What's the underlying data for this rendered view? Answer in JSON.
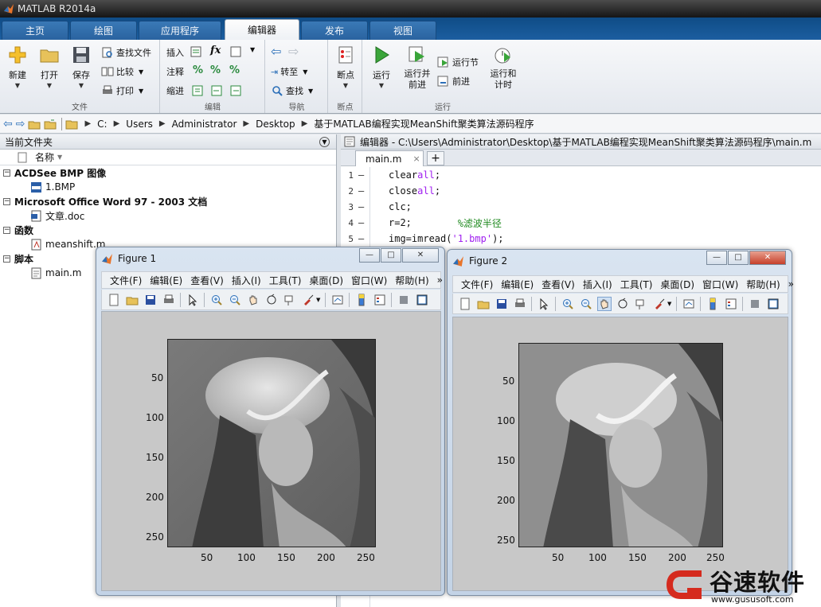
{
  "window": {
    "title": "MATLAB R2014a"
  },
  "tabs": [
    {
      "label": "主页"
    },
    {
      "label": "绘图"
    },
    {
      "label": "应用程序"
    },
    {
      "label": "编辑器",
      "active": true
    },
    {
      "label": "发布"
    },
    {
      "label": "视图"
    }
  ],
  "ribbon": {
    "file": {
      "label": "文件",
      "new": "新建",
      "open": "打开",
      "save": "保存",
      "find_files": "查找文件",
      "compare": "比较",
      "print": "打印"
    },
    "edit": {
      "label": "编辑",
      "insert": "插入",
      "comment": "注释",
      "indent": "缩进",
      "fx": "fx"
    },
    "navigate": {
      "label": "导航",
      "goto": "转至",
      "find": "查找"
    },
    "breakpoints": {
      "label": "断点",
      "breakpoint": "断点"
    },
    "run": {
      "label": "运行",
      "run": "运行",
      "run_advance": "运行并\n前进",
      "run_section": "运行节",
      "advance": "前进",
      "run_time": "运行和\n计时"
    }
  },
  "path": {
    "crumbs": [
      "C:",
      "Users",
      "Administrator",
      "Desktop",
      "基于MATLAB编程实现MeanShift聚类算法源码程序"
    ]
  },
  "current_folder": {
    "title": "当前文件夹",
    "name_col": "名称",
    "groups": [
      {
        "label": "ACDSee BMP 图像",
        "files": [
          "1.BMP"
        ]
      },
      {
        "label": "Microsoft Office Word 97 - 2003 文档",
        "files": [
          "文章.doc"
        ]
      },
      {
        "label": "函数",
        "files": [
          "meanshift.m"
        ]
      },
      {
        "label": "脚本",
        "files": [
          "main.m"
        ]
      }
    ]
  },
  "editor": {
    "title": "编辑器 - C:\\Users\\Administrator\\Desktop\\基于MATLAB编程实现MeanShift聚类算法源码程序\\main.m",
    "tab": "main.m",
    "close_symbol": "×",
    "plus_symbol": "+",
    "lines": [
      {
        "n": "1",
        "a": "clear ",
        "b": "all",
        "c": ";",
        "comment": ""
      },
      {
        "n": "2",
        "a": "close ",
        "b": "all",
        "c": ";",
        "comment": ""
      },
      {
        "n": "3",
        "a": "clc;",
        "b": "",
        "c": "",
        "comment": ""
      },
      {
        "n": "4",
        "a": "r=2;        ",
        "b": "",
        "c": "",
        "comment": "%滤波半径"
      },
      {
        "n": "5",
        "a": "img=imread(",
        "b": "'1.bmp'",
        "c": ");",
        "comment": ""
      }
    ]
  },
  "figures": [
    {
      "title": "Figure 1",
      "menu": [
        "文件(F)",
        "编辑(E)",
        "查看(V)",
        "插入(I)",
        "工具(T)",
        "桌面(D)",
        "窗口(W)",
        "帮助(H)"
      ],
      "xticks": [
        "50",
        "100",
        "150",
        "200",
        "250"
      ],
      "yticks": [
        "50",
        "100",
        "150",
        "200",
        "250"
      ]
    },
    {
      "title": "Figure 2",
      "menu": [
        "文件(F)",
        "编辑(E)",
        "查看(V)",
        "插入(I)",
        "工具(T)",
        "桌面(D)",
        "窗口(W)",
        "帮助(H)"
      ],
      "xticks": [
        "50",
        "100",
        "150",
        "200",
        "250"
      ],
      "yticks": [
        "50",
        "100",
        "150",
        "200",
        "250"
      ]
    }
  ],
  "watermark": {
    "brand": "谷速软件",
    "url": "www.gususoft.com"
  },
  "colors": {
    "accent": "#1c5ea0",
    "keyword": "#a020f0",
    "comment": "#228b22"
  }
}
